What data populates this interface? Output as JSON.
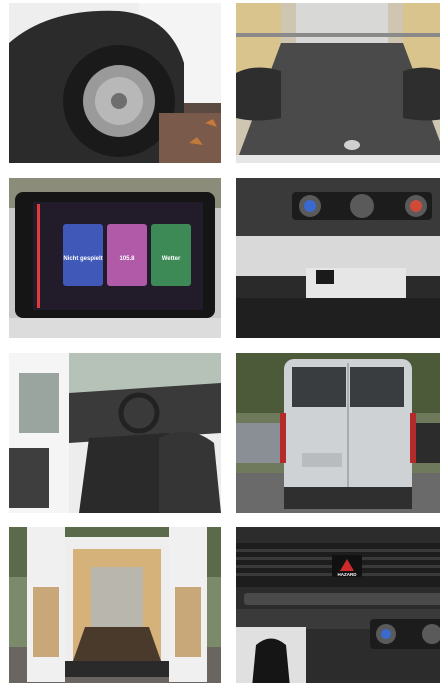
{
  "gallery": {
    "photos": [
      {
        "subject": "front-wheel",
        "row": 0,
        "col": 0
      },
      {
        "subject": "cargo-floor",
        "row": 0,
        "col": 1
      },
      {
        "subject": "infotainment-screen",
        "row": 1,
        "col": 0
      },
      {
        "subject": "climate-controls",
        "row": 1,
        "col": 1
      },
      {
        "subject": "cab-interior",
        "row": 2,
        "col": 0
      },
      {
        "subject": "van-rear",
        "row": 2,
        "col": 1
      },
      {
        "subject": "open-rear-doors",
        "row": 3,
        "col": 0
      },
      {
        "subject": "dashboard-vents",
        "row": 3,
        "col": 1
      }
    ],
    "screen_texts": {
      "tile1": "Nicht gespielt",
      "tile2": "105.8",
      "tile3": "Wetter"
    },
    "hazard_label": "HAZARD"
  }
}
